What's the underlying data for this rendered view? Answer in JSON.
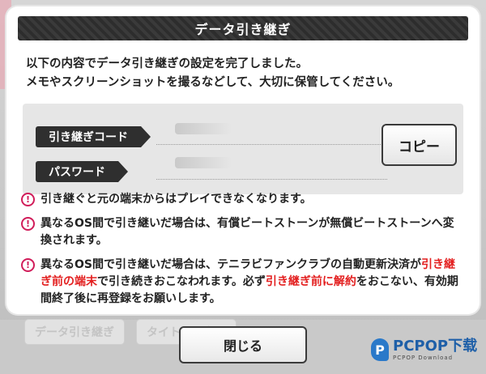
{
  "dialog": {
    "title": "データ引き継ぎ",
    "message_line1": "以下の内容でデータ引き継ぎの設定を完了しました。",
    "message_line2": "メモやスクリーンショットを撮るなどして、大切に保管してください。"
  },
  "fields": {
    "code_label": "引き継ぎコード",
    "password_label": "パスワード"
  },
  "copy_button": "コピー",
  "notes": [
    {
      "text": "引き継ぐと元の端末からはプレイできなくなります。"
    },
    {
      "text": "異なるOS間で引き継いだ場合は、有償ビートストーンが無償ビートストーンへ変換されます。"
    },
    {
      "part1": "異なるOS間で引き継いだ場合は、テニラビファンクラブの自動更新決済が",
      "red1": "引き継ぎ前の端末",
      "part2": "で引き続きおこなわれます。必ず",
      "red2": "引き継ぎ前に解約",
      "part3": "をおこない、有効期間終了後に再登録をお願いします。"
    }
  ],
  "close_button": "閉じる",
  "background_buttons": [
    "データ引き継ぎ",
    "タイトルへ戻る"
  ],
  "watermark": {
    "brand": "PCPOP下载",
    "sub": "PCPOP Download"
  },
  "colors": {
    "warning": "#d11d5a",
    "emphasis": "#e32020",
    "header_bg": "#2d2d2d"
  }
}
